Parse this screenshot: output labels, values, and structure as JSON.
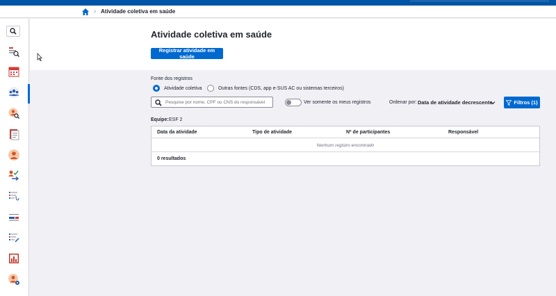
{
  "breadcrumb": {
    "home_icon": "home-icon",
    "current": "Atividade coletiva em saúde"
  },
  "sidebar": {
    "items": [
      {
        "name": "search-icon"
      },
      {
        "name": "citizen-search-icon"
      },
      {
        "name": "agenda-icon"
      },
      {
        "name": "collective-activity-icon",
        "active": true
      },
      {
        "name": "person-search-icon"
      },
      {
        "name": "records-icon"
      },
      {
        "name": "user-icon"
      },
      {
        "name": "user-check-icon"
      },
      {
        "name": "list-stethoscope-icon"
      },
      {
        "name": "list-flag-icon"
      },
      {
        "name": "list-edit-icon"
      },
      {
        "name": "reports-chart-icon"
      },
      {
        "name": "user-settings-icon"
      }
    ]
  },
  "page": {
    "title": "Atividade coletiva em saúde",
    "register_button": "Registrar atividade em saúde"
  },
  "filters": {
    "source_label": "Fonte dos registros",
    "radio_options": [
      {
        "label": "Atividade coletiva",
        "checked": true
      },
      {
        "label": "Outras fontes (CDS, app e-SUS AC ou sistemas terceiros)",
        "checked": false
      }
    ],
    "search_placeholder": "Pesquise por nome, CPF ou CNS do responsável",
    "toggle_label": "Ver somente os meus registros",
    "toggle_on": false,
    "sort_label": "Ordenar por:",
    "sort_value": "Data de atividade decrescente",
    "filter_button": "Filtros (1)"
  },
  "team": {
    "label": "Equipe:",
    "value": "ESF 2"
  },
  "table": {
    "columns": [
      "Data da atividade",
      "Tipo de atividade",
      "Nº de participantes",
      "Responsável"
    ],
    "empty_message": "Nenhum registro encontrado",
    "results": "0 resultados"
  },
  "colors": {
    "primary": "#0069d0",
    "topbar": "#0054a6",
    "background": "#f0f0f5"
  }
}
